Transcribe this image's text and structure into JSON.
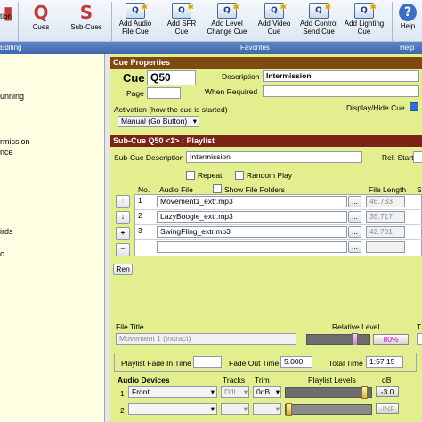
{
  "toolbar": {
    "left_partial": "tion",
    "cues_label": "Cues",
    "subcues_label": "Sub-Cues",
    "buttons": [
      {
        "label": "Add Audio File Cue",
        "line1": "Add Audio",
        "line2": "File Cue",
        "badge": "AU"
      },
      {
        "label": "Add SFR Cue",
        "line1": "Add SFR",
        "line2": "Cue",
        "badge": "SF"
      },
      {
        "label": "Add Level Change Cue",
        "line1": "Add Level",
        "line2": "Change Cue",
        "badge": "LV"
      },
      {
        "label": "Add Video Cue",
        "line1": "Add Video",
        "line2": "Cue",
        "badge": "VI"
      },
      {
        "label": "Add Control Send Cue",
        "line1": "Add Control",
        "line2": "Send Cue",
        "badge": "CS"
      },
      {
        "label": "Add Lighting Cue",
        "line1": "Add Lighting",
        "line2": "Cue",
        "badge": "LT"
      }
    ],
    "help_label": "Help"
  },
  "groups": {
    "editing": "Editing",
    "favorites": "Favorites",
    "help": "Help"
  },
  "left_list": [
    "unning",
    "rmission",
    "nce",
    "irds",
    "c"
  ],
  "cue_properties": {
    "header": "Cue Properties",
    "cue_label": "Cue",
    "cue_value": "Q50",
    "page_label": "Page",
    "page_value": "",
    "description_label": "Description",
    "description_value": "Intermission",
    "when_required_label": "When Required",
    "when_required_value": "",
    "activation_label": "Activation (how the cue is started)",
    "activation_value": "Manual (Go Button)",
    "display_hide_label": "Display/Hide Cue"
  },
  "subcue": {
    "header": "Sub-Cue Q50 <1> : Playlist",
    "description_label": "Sub-Cue Description",
    "description_value": "Intermission",
    "rel_start_label": "Rel. Start",
    "repeat_label": "Repeat",
    "random_play_label": "Random Play",
    "col_no": "No.",
    "col_audio_file": "Audio File",
    "show_file_folders_label": "Show File Folders",
    "col_file_length": "File Length",
    "col_s_partial": "S",
    "files": [
      {
        "no": "1",
        "file": "Movement1_extr.mp3",
        "length": "46.733"
      },
      {
        "no": "2",
        "file": "LazyBoogie_extr.mp3",
        "length": "35.717"
      },
      {
        "no": "3",
        "file": "SwingFling_extr.mp3",
        "length": "42.701"
      }
    ],
    "ren_label": "Ren",
    "file_title_label": "File Title",
    "file_title_value": "Movement 1 (extract)",
    "relative_level_label": "Relative Level",
    "relative_level_value": "80%",
    "relative_level_fraction": 0.8,
    "t_partial": "T",
    "fade_in_label": "Playlist Fade In Time",
    "fade_in_value": "",
    "fade_out_label": "Fade Out Time",
    "fade_out_value": "5.000",
    "total_time_label": "Total Time",
    "total_time_value": "1:57.15",
    "audio_devices_label": "Audio Devices",
    "tracks_label": "Tracks",
    "trim_label": "Trim",
    "playlist_levels_label": "Playlist Levels",
    "db_label": "dB",
    "devices": [
      {
        "no": "1",
        "device": "Front",
        "tracks": "Dflt",
        "trim": "0dB",
        "level": "-3.0"
      },
      {
        "no": "2",
        "device": "",
        "tracks": "",
        "trim": "",
        "level": "-INF"
      }
    ]
  }
}
